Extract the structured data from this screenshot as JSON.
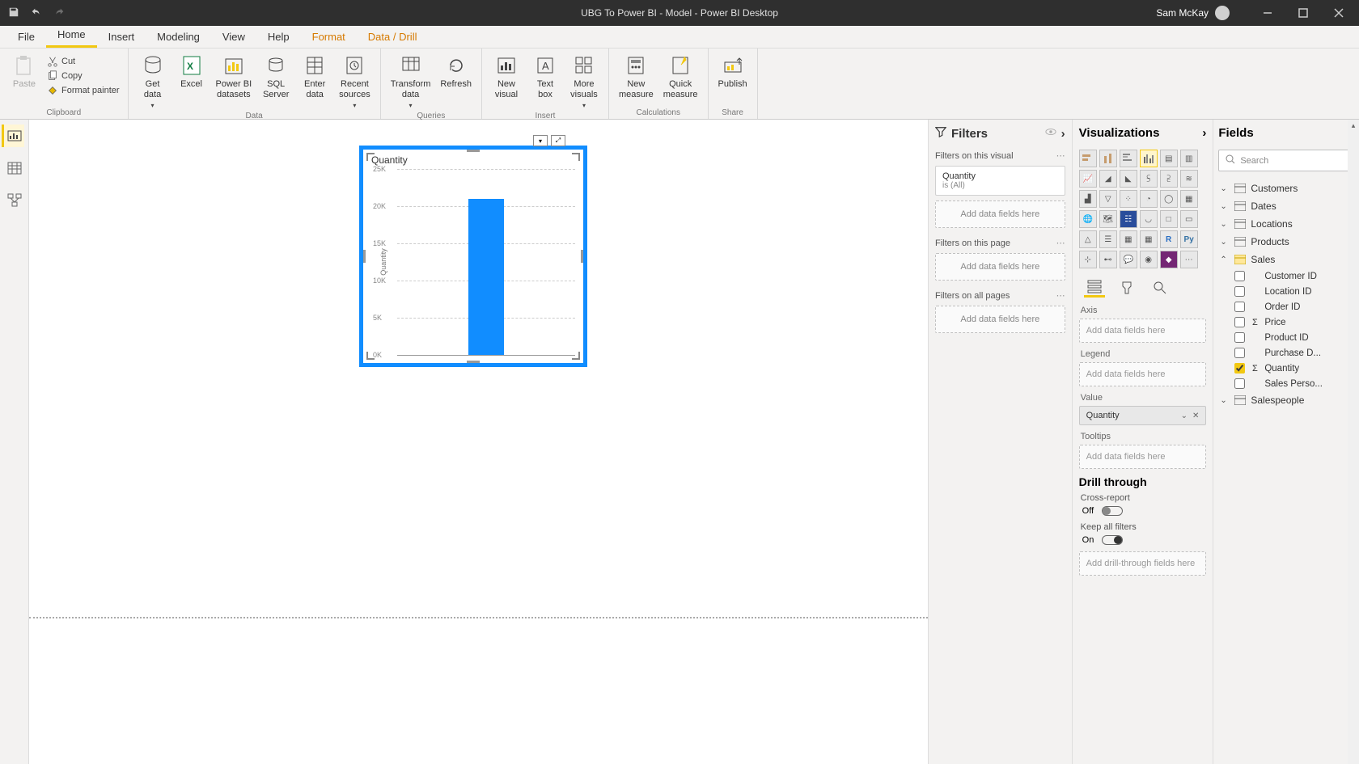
{
  "titlebar": {
    "title": "UBG To Power BI - Model - Power BI Desktop",
    "username": "Sam McKay"
  },
  "menutabs": {
    "file": "File",
    "home": "Home",
    "insert": "Insert",
    "modeling": "Modeling",
    "view": "View",
    "help": "Help",
    "format": "Format",
    "datadrill": "Data / Drill"
  },
  "ribbon": {
    "clipboard": {
      "label": "Clipboard",
      "paste": "Paste",
      "cut": "Cut",
      "copy": "Copy",
      "fmt": "Format painter"
    },
    "data": {
      "label": "Data",
      "getdata": "Get\ndata",
      "excel": "Excel",
      "pbids": "Power BI\ndatasets",
      "sql": "SQL\nServer",
      "enter": "Enter\ndata",
      "recent": "Recent\nsources"
    },
    "queries": {
      "label": "Queries",
      "transform": "Transform\ndata",
      "refresh": "Refresh"
    },
    "insert": {
      "label": "Insert",
      "visual": "New\nvisual",
      "textbox": "Text\nbox",
      "more": "More\nvisuals"
    },
    "calc": {
      "label": "Calculations",
      "measure": "New\nmeasure",
      "quick": "Quick\nmeasure"
    },
    "share": {
      "label": "Share",
      "publish": "Publish"
    }
  },
  "filters": {
    "header": "Filters",
    "onvisual": "Filters on this visual",
    "quantity": "Quantity",
    "isall": "is (All)",
    "addfields": "Add data fields here",
    "onpage": "Filters on this page",
    "onall": "Filters on all pages"
  },
  "viz": {
    "header": "Visualizations",
    "axis": "Axis",
    "legend": "Legend",
    "value": "Value",
    "valuefield": "Quantity",
    "tooltips": "Tooltips",
    "addfields": "Add data fields here",
    "drillthrough": "Drill through",
    "crossreport": "Cross-report",
    "off": "Off",
    "keepall": "Keep all filters",
    "on": "On",
    "adddrill": "Add drill-through fields here"
  },
  "fields": {
    "header": "Fields",
    "search": "Search",
    "tables": {
      "customers": "Customers",
      "dates": "Dates",
      "locations": "Locations",
      "products": "Products",
      "sales": "Sales",
      "salespeople": "Salespeople"
    },
    "sales_fields": {
      "customerid": "Customer ID",
      "locationid": "Location ID",
      "orderid": "Order ID",
      "price": "Price",
      "productid": "Product ID",
      "purchased": "Purchase D...",
      "quantity": "Quantity",
      "salesperson": "Sales Perso..."
    }
  },
  "chart_data": {
    "type": "bar",
    "title": "Quantity",
    "ylabel": "Quantity",
    "categories": [
      ""
    ],
    "values": [
      21000
    ],
    "ticks": [
      "0K",
      "5K",
      "10K",
      "15K",
      "20K",
      "25K"
    ],
    "ylim": [
      0,
      25000
    ]
  }
}
